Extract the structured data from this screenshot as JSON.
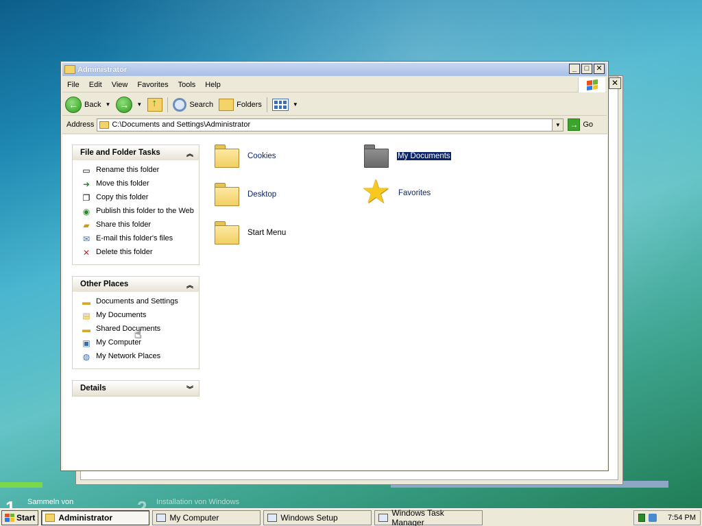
{
  "window": {
    "title": "Administrator",
    "menu": [
      "File",
      "Edit",
      "View",
      "Favorites",
      "Tools",
      "Help"
    ],
    "controls": {
      "minimize": "_",
      "maximize": "□",
      "close": "✕"
    }
  },
  "toolbar": {
    "back_label": "Back",
    "search_label": "Search",
    "folders_label": "Folders"
  },
  "address": {
    "label": "Address",
    "value": "C:\\Documents and Settings\\Administrator",
    "go_label": "Go"
  },
  "taskpane": {
    "file_tasks": {
      "title": "File and Folder Tasks",
      "items": [
        {
          "label": "Rename this folder",
          "icon": "rename-icon"
        },
        {
          "label": "Move this folder",
          "icon": "move-icon"
        },
        {
          "label": "Copy this folder",
          "icon": "copy-icon"
        },
        {
          "label": "Publish this folder to the Web",
          "icon": "publish-web-icon"
        },
        {
          "label": "Share this folder",
          "icon": "share-icon"
        },
        {
          "label": "E-mail this folder's files",
          "icon": "email-icon"
        },
        {
          "label": "Delete this folder",
          "icon": "delete-icon"
        }
      ]
    },
    "other_places": {
      "title": "Other Places",
      "items": [
        {
          "label": "Documents and Settings",
          "icon": "folder-icon"
        },
        {
          "label": "My Documents",
          "icon": "my-documents-icon"
        },
        {
          "label": "Shared Documents",
          "icon": "folder-icon"
        },
        {
          "label": "My Computer",
          "icon": "computer-icon"
        },
        {
          "label": "My Network Places",
          "icon": "network-icon"
        }
      ]
    },
    "details": {
      "title": "Details"
    }
  },
  "files": [
    {
      "name": "Cookies",
      "type": "folder",
      "selected": false
    },
    {
      "name": "My Documents",
      "type": "special-folder",
      "selected": true
    },
    {
      "name": "Desktop",
      "type": "folder",
      "selected": false
    },
    {
      "name": "Favorites",
      "type": "favorites",
      "selected": false
    },
    {
      "name": "Start Menu",
      "type": "folder",
      "selected": false
    }
  ],
  "desktop": {
    "setup_steps": [
      {
        "number": "1",
        "label": "Sammeln von"
      },
      {
        "number": "2",
        "label": "Installation von Windows"
      }
    ]
  },
  "taskbar": {
    "start_label": "Start",
    "tasks": [
      {
        "label": "Administrator",
        "active": true
      },
      {
        "label": "My Computer",
        "active": false
      },
      {
        "label": "Windows Setup",
        "active": false
      },
      {
        "label": "Windows Task Manager",
        "active": false
      }
    ],
    "clock": "7:54 PM"
  }
}
